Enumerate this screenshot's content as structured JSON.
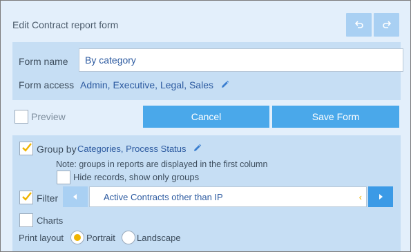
{
  "header": {
    "title": "Edit Contract report form",
    "undo_icon": "undo-icon",
    "redo_icon": "redo-icon"
  },
  "form": {
    "name_label": "Form name",
    "name_value": "By category",
    "access_label": "Form access",
    "access_value": "Admin, Executive, Legal, Sales"
  },
  "actions": {
    "preview_label": "Preview",
    "preview_checked": false,
    "cancel_label": "Cancel",
    "save_label": "Save Form"
  },
  "options": {
    "group_by_label": "Group by",
    "group_by_checked": true,
    "group_by_value": "Categories, Process Status",
    "note": "Note: groups in reports are displayed in the first column",
    "hide_records_label": "Hide records, show only groups",
    "hide_records_checked": false,
    "filter_label": "Filter",
    "filter_checked": true,
    "filter_value": "Active Contracts other than IP",
    "charts_label": "Charts",
    "charts_checked": false,
    "print_layout_label": "Print layout",
    "portrait_label": "Portrait",
    "landscape_label": "Landscape",
    "print_layout_selected": "Portrait"
  },
  "colors": {
    "background": "#e3effb",
    "panel": "#c6def4",
    "accent": "#4aa8ea",
    "check_mark": "#f0b400",
    "link": "#2c5aa0"
  }
}
